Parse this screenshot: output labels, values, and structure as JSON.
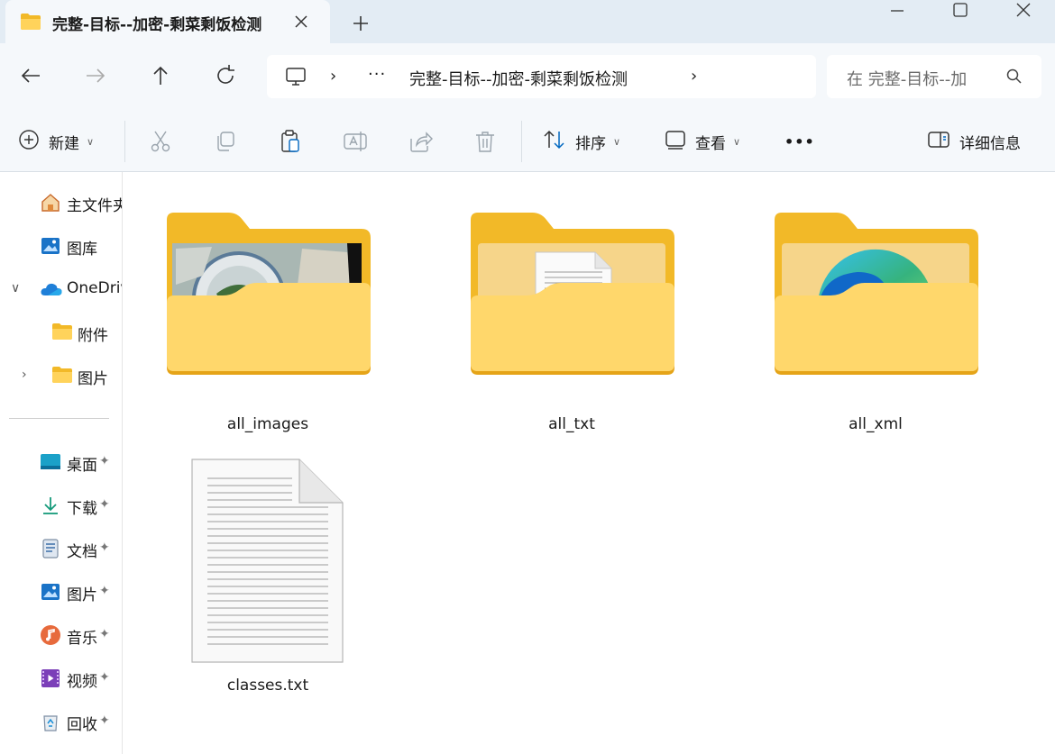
{
  "window": {
    "tab_title": "完整-目标--加密-剩菜剩饭检测",
    "new_tab_icon": "plus-icon",
    "controls": [
      "minimize-icon",
      "maximize-icon",
      "close-icon"
    ]
  },
  "address": {
    "overflow": "···",
    "crumb": "完整-目标--加密-剩菜剩饭检测",
    "separator": "›"
  },
  "search": {
    "placeholder": "在 完整-目标--加"
  },
  "commands": {
    "new_label": "新建",
    "sort_label": "排序",
    "view_label": "查看",
    "more_label": "•••",
    "details_label": "详细信息"
  },
  "sidebar": {
    "items": [
      {
        "label": "主文件夹",
        "icon": "home-icon"
      },
      {
        "label": "图库",
        "icon": "gallery-icon"
      },
      {
        "label": "OneDrive",
        "icon": "cloud-icon"
      },
      {
        "label": "附件",
        "icon": "folder-icon"
      },
      {
        "label": "图片",
        "icon": "folder-icon"
      },
      {
        "label": "桌面",
        "icon": "desktop-icon"
      },
      {
        "label": "下载",
        "icon": "download-icon"
      },
      {
        "label": "文档",
        "icon": "document-icon"
      },
      {
        "label": "图片",
        "icon": "pictures-icon"
      },
      {
        "label": "音乐",
        "icon": "music-icon"
      },
      {
        "label": "视频",
        "icon": "video-icon"
      },
      {
        "label": "回收",
        "icon": "recycle-bin-icon"
      }
    ],
    "pin_glyph": "📌",
    "expand_open": "∨",
    "expand_closed": "›"
  },
  "files": [
    {
      "name": "all_images",
      "kind": "folder-with-photo"
    },
    {
      "name": "all_txt",
      "kind": "folder-with-document"
    },
    {
      "name": "all_xml",
      "kind": "folder-with-edge"
    },
    {
      "name": "classes.txt",
      "kind": "text-file"
    }
  ],
  "colors": {
    "folder_back": "#f2b928",
    "folder_front": "#ffd76b",
    "accent": "#0067c0"
  }
}
